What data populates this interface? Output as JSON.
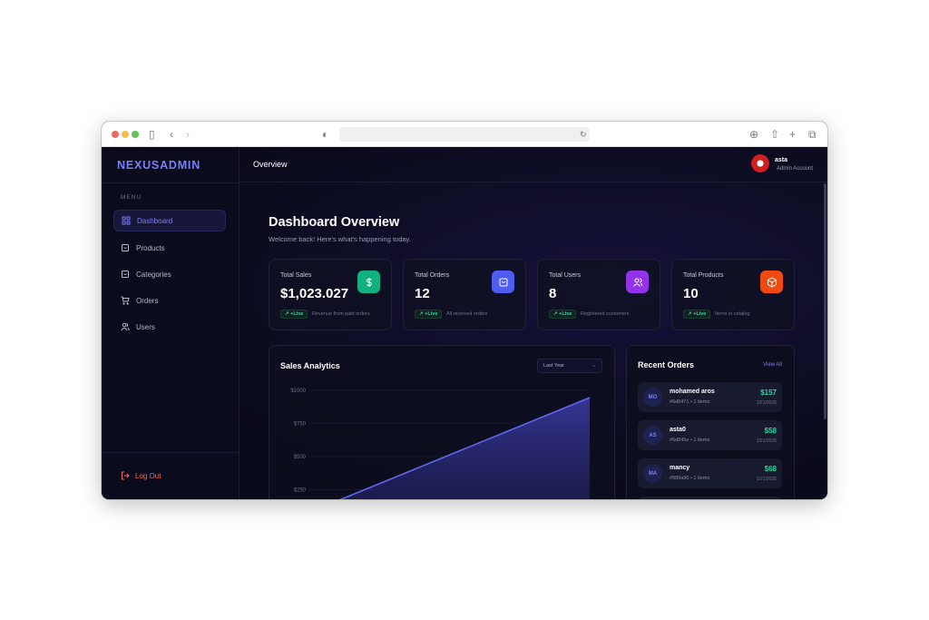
{
  "browser": {
    "address": ""
  },
  "app": {
    "logo": "NEXUSADMIN",
    "header_title": "Overview",
    "user": {
      "name": "asta",
      "role": "Admin Account"
    }
  },
  "sidebar": {
    "menu_label": "MENU",
    "items": [
      {
        "label": "Dashboard",
        "icon": "grid-icon",
        "active": true
      },
      {
        "label": "Products",
        "icon": "bag-icon"
      },
      {
        "label": "Categories",
        "icon": "bag-icon"
      },
      {
        "label": "Orders",
        "icon": "cart-icon"
      },
      {
        "label": "Users",
        "icon": "users-icon"
      }
    ],
    "logout": "Log Out"
  },
  "page": {
    "title": "Dashboard Overview",
    "subtitle": "Welcome back! Here's what's happening today."
  },
  "stats": [
    {
      "label": "Total Sales",
      "value": "$1,023.027",
      "badge": "+Live",
      "note": "Revenue from paid orders",
      "icon": "dollar-icon",
      "color": "#10b07f"
    },
    {
      "label": "Total Orders",
      "value": "12",
      "badge": "+Live",
      "note": "All received orders",
      "icon": "shopping-bag-icon",
      "color": "#4f5cf0"
    },
    {
      "label": "Total Users",
      "value": "8",
      "badge": "+Live",
      "note": "Registered customers",
      "icon": "users-icon",
      "color": "#9233ea"
    },
    {
      "label": "Total Products",
      "value": "10",
      "badge": "+Live",
      "note": "Items in catalog",
      "icon": "box-icon",
      "color": "#f04a12"
    }
  ],
  "analytics": {
    "title": "Sales Analytics",
    "range": "Last Year"
  },
  "chart_data": {
    "type": "area",
    "title": "Sales Analytics",
    "y_ticks": [
      "$1000",
      "$750",
      "$500",
      "$250"
    ],
    "ylim": [
      0,
      1000
    ],
    "series": [
      {
        "name": "Sales",
        "values": [
          80,
          945
        ]
      }
    ],
    "grid": true,
    "color": "#6366f1"
  },
  "recent_orders": {
    "title": "Recent Orders",
    "view_all": "View All",
    "items": [
      {
        "initials": "MO",
        "name": "mohamed aros",
        "meta": "#6d8471 • 1 items",
        "amount": "$157",
        "date": "1/21/2026"
      },
      {
        "initials": "AS",
        "name": "asta0",
        "meta": "#6d845e • 1 items",
        "amount": "$58",
        "date": "1/21/2026"
      },
      {
        "initials": "MA",
        "name": "mancy",
        "meta": "#989a90 • 1 items",
        "amount": "$68",
        "date": "1/21/2026"
      }
    ]
  }
}
